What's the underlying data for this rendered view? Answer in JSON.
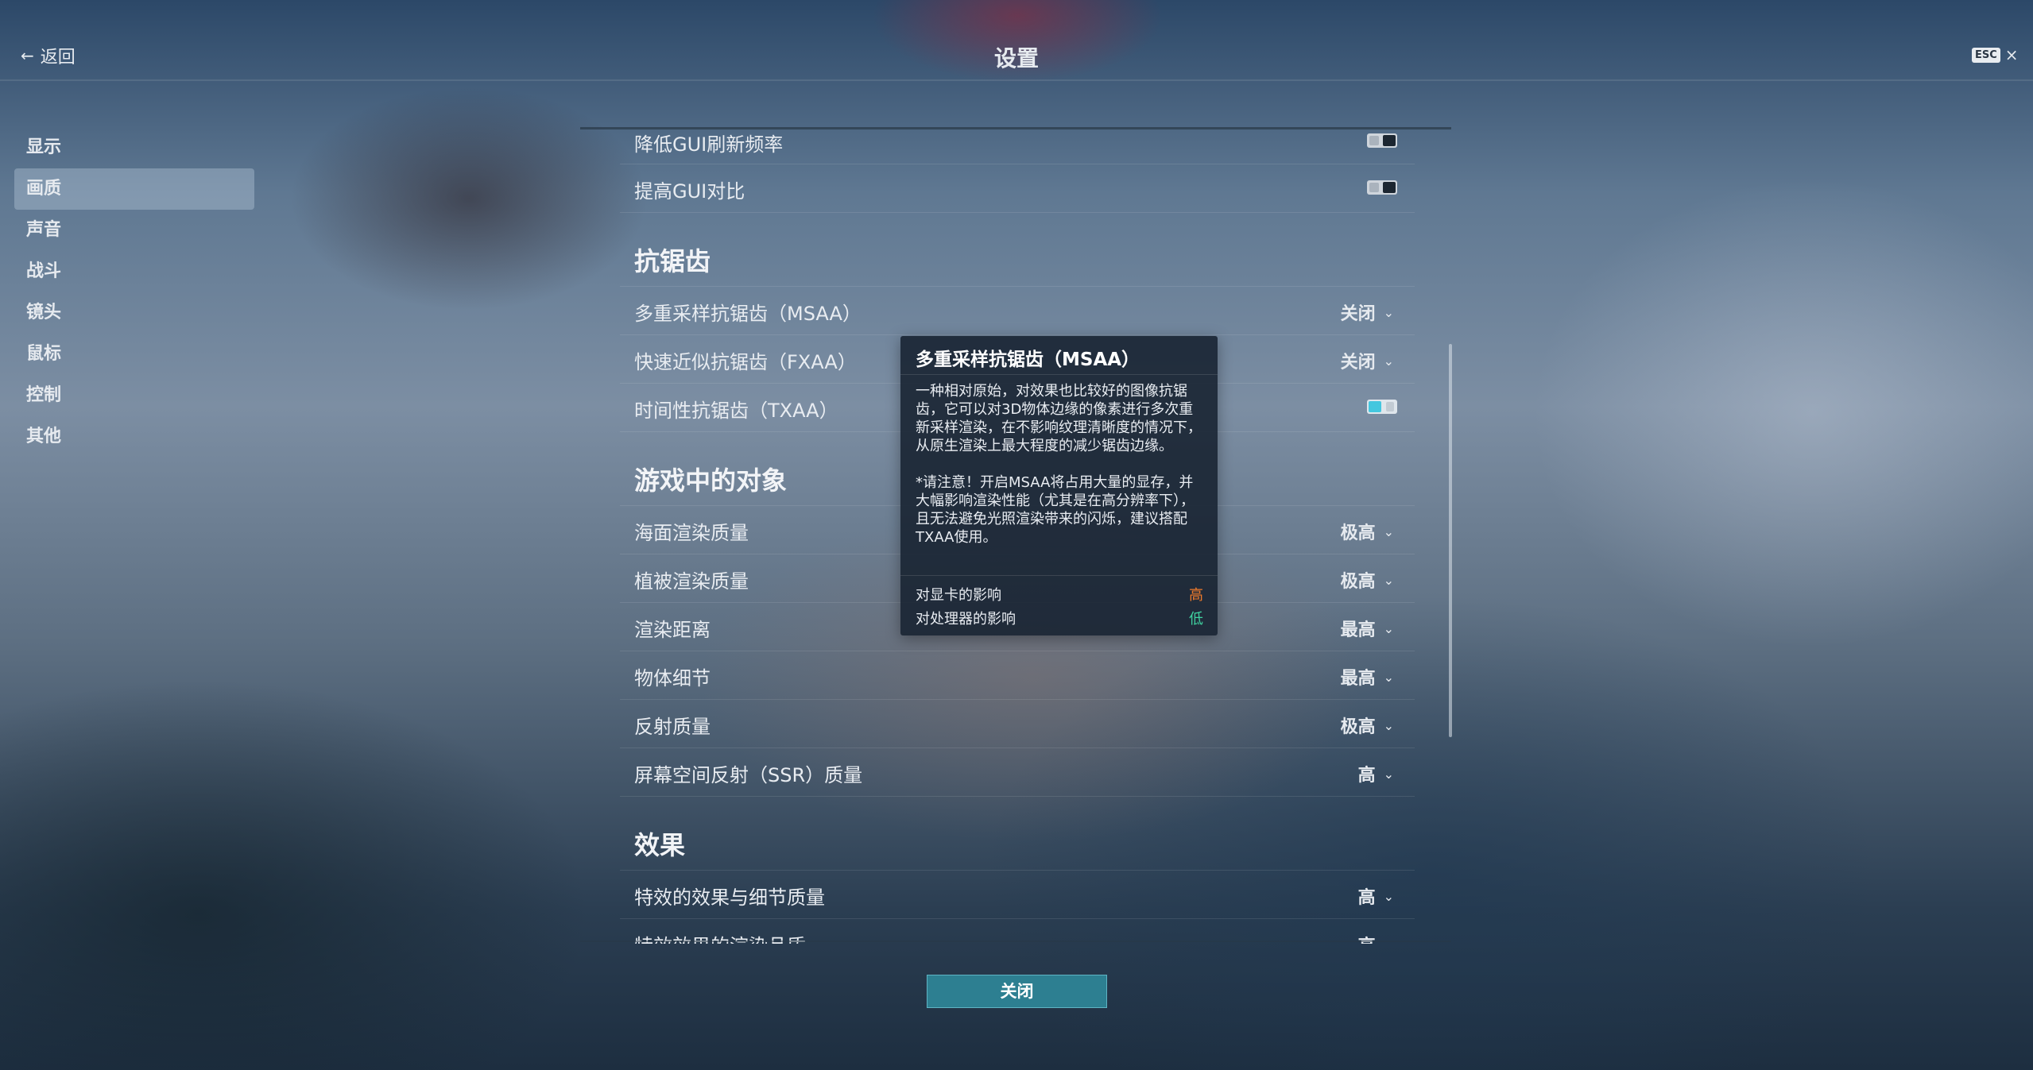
{
  "header": {
    "back_label": "返回",
    "title": "设置",
    "esc_label": "ESC",
    "close_glyph": "×"
  },
  "sidebar": {
    "items": [
      {
        "label": "显示",
        "active": false
      },
      {
        "label": "画质",
        "active": true
      },
      {
        "label": "声音",
        "active": false
      },
      {
        "label": "战斗",
        "active": false
      },
      {
        "label": "镜头",
        "active": false
      },
      {
        "label": "鼠标",
        "active": false
      },
      {
        "label": "控制",
        "active": false
      },
      {
        "label": "其他",
        "active": false
      }
    ]
  },
  "settings": {
    "gui_rows": [
      {
        "label": "降低GUI刷新频率",
        "toggle": "off"
      },
      {
        "label": "提高GUI对比",
        "toggle": "off"
      }
    ],
    "antialias": {
      "title": "抗锯齿",
      "rows": [
        {
          "label": "多重采样抗锯齿（MSAA）",
          "value": "关闭"
        },
        {
          "label": "快速近似抗锯齿（FXAA）",
          "value": "关闭"
        },
        {
          "label": "时间性抗锯齿（TXAA）",
          "toggle": "on"
        }
      ]
    },
    "objects": {
      "title": "游戏中的对象",
      "rows": [
        {
          "label": "海面渲染质量",
          "value": "极高"
        },
        {
          "label": "植被渲染质量",
          "value": "极高"
        },
        {
          "label": "渲染距离",
          "value": "最高"
        },
        {
          "label": "物体细节",
          "value": "最高"
        },
        {
          "label": "反射质量",
          "value": "极高"
        },
        {
          "label": "屏幕空间反射（SSR）质量",
          "value": "高"
        }
      ]
    },
    "effects": {
      "title": "效果",
      "rows": [
        {
          "label": "特效的效果与细节质量",
          "value": "高"
        },
        {
          "label": "特效效果的渲染品质",
          "value": "高"
        }
      ]
    }
  },
  "tooltip": {
    "title": "多重采样抗锯齿（MSAA）",
    "para1": "一种相对原始，对效果也比较好的图像抗锯齿，它可以对3D物体边缘的像素进行多次重新采样渲染，在不影响纹理清晰度的情况下，从原生渲染上最大程度的减少锯齿边缘。",
    "para2": "*请注意！开启MSAA将占用大量的显存，并大幅影响渲染性能（尤其是在高分辨率下），且无法避免光照渲染带来的闪烁，建议搭配TXAA使用。",
    "gpu_label": "对显卡的影响",
    "gpu_value": "高",
    "cpu_label": "对处理器的影响",
    "cpu_value": "低"
  },
  "footer": {
    "close_label": "关闭"
  },
  "colors": {
    "accent_button": "#2d7f91",
    "toggle_on": "#44c7df",
    "impact_high": "#f07a2a",
    "impact_low": "#3fd2a0"
  },
  "icons": {
    "back": "arrow-left-icon",
    "chevron": "chevron-down-icon",
    "close": "close-icon"
  }
}
